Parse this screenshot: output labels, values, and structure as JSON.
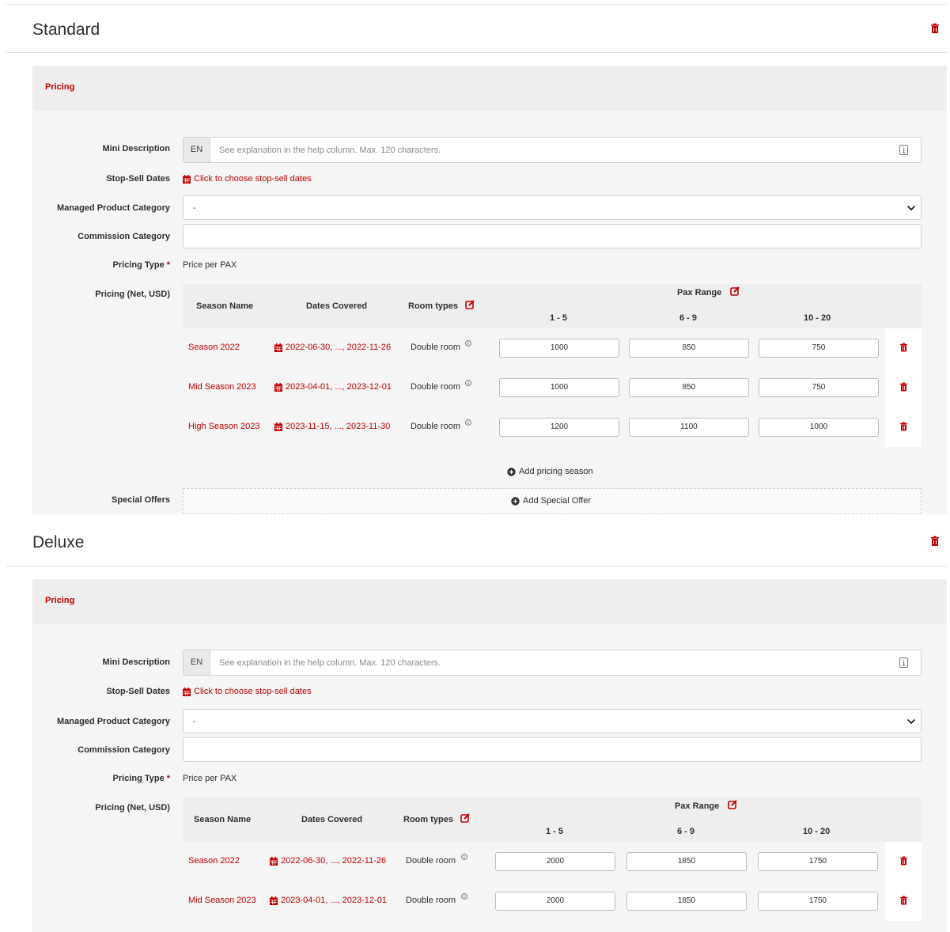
{
  "labels": {
    "pricing_tab": "Pricing",
    "mini_description": "Mini Description",
    "stop_sell_dates": "Stop-Sell Dates",
    "managed_product_category": "Managed Product Category",
    "commission_category": "Commission Category",
    "pricing_type": "Pricing Type",
    "required_mark": "*",
    "pricing_net": "Pricing (Net, USD)",
    "special_offers": "Special Offers",
    "lang_code": "EN",
    "mini_placeholder": "See explanation in the help column. Max. 120 characters.",
    "stop_sell_link": "Click to choose stop-sell dates",
    "category_default": "-",
    "pricing_type_value": "Price per PAX",
    "col_season_name": "Season Name",
    "col_dates_covered": "Dates Covered",
    "col_room_types": "Room types",
    "col_pax_range": "Pax Range",
    "pax_ranges": [
      "1 - 5",
      "6 - 9",
      "10 - 20"
    ],
    "add_pricing_season": "Add pricing season",
    "add_special_offer": "Add Special Offer"
  },
  "sections": [
    {
      "title": "Standard",
      "rows": [
        {
          "season": "Season 2022",
          "dates": "2022-06-30, ..., 2022-11-26",
          "room": "Double room",
          "prices": [
            "1000",
            "850",
            "750"
          ]
        },
        {
          "season": "Mid Season 2023",
          "dates": "2023-04-01, ..., 2023-12-01",
          "room": "Double room",
          "prices": [
            "1000",
            "850",
            "750"
          ]
        },
        {
          "season": "High Season 2023",
          "dates": "2023-11-15, ..., 2023-11-30",
          "room": "Double room",
          "prices": [
            "1200",
            "1100",
            "1000"
          ]
        }
      ]
    },
    {
      "title": "Deluxe",
      "rows": [
        {
          "season": "Season 2022",
          "dates": "2022-06-30, ..., 2022-11-26",
          "room": "Double room",
          "prices": [
            "2000",
            "1850",
            "1750"
          ]
        },
        {
          "season": "Mid Season 2023",
          "dates": "2023-04-01, ..., 2023-12-01",
          "room": "Double room",
          "prices": [
            "2000",
            "1850",
            "1750"
          ]
        }
      ]
    }
  ],
  "colors": {
    "accent": "#c00000",
    "panel": "#f5f5f5",
    "header": "#eeeeee"
  }
}
